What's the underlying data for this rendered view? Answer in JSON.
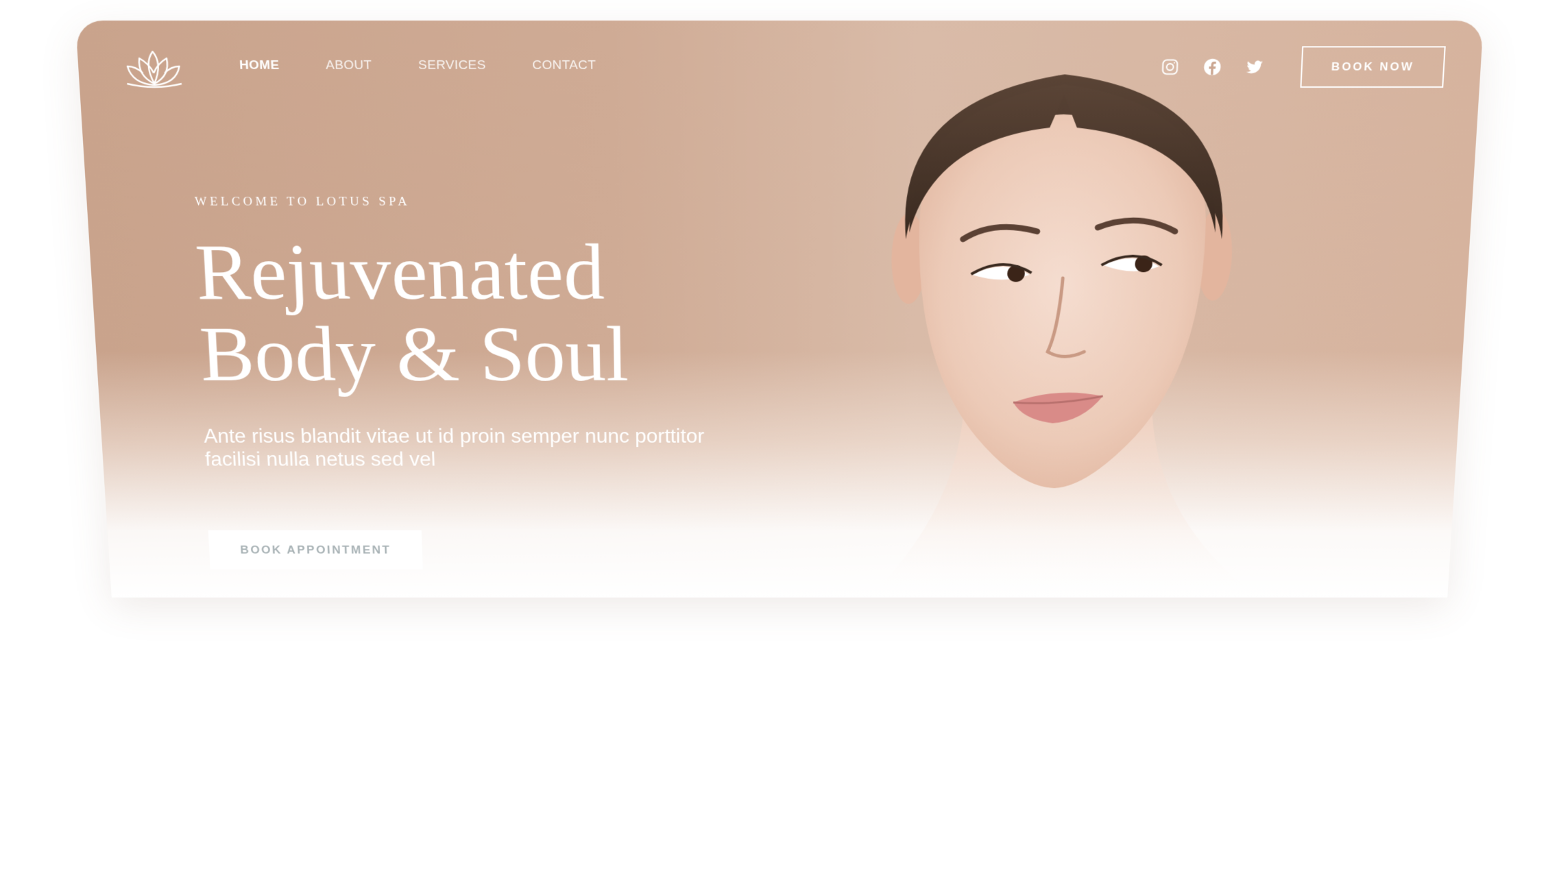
{
  "brand": {
    "logo_icon": "lotus-icon"
  },
  "nav": {
    "items": [
      {
        "label": "HOME",
        "active": true
      },
      {
        "label": "ABOUT",
        "active": false
      },
      {
        "label": "SERVICES",
        "active": false
      },
      {
        "label": "CONTACT",
        "active": false
      }
    ],
    "socials": [
      {
        "icon": "instagram-icon"
      },
      {
        "icon": "facebook-icon"
      },
      {
        "icon": "twitter-icon"
      }
    ],
    "book_now_label": "BOOK NOW"
  },
  "hero": {
    "eyebrow": "WELCOME TO LOTUS SPA",
    "headline_line1": "Rejuvenated",
    "headline_line2": "Body & Soul",
    "subtext": "Ante risus blandit vitae ut id proin semper nunc porttitor facilisi nulla netus sed vel",
    "cta_label": "BOOK APPOINTMENT",
    "image": "woman-portrait-image"
  },
  "colors": {
    "hero_background": "#cba690",
    "text_on_hero": "#ffffff",
    "cta_text": "#a9b3b6",
    "page_background": "#ffffff"
  }
}
